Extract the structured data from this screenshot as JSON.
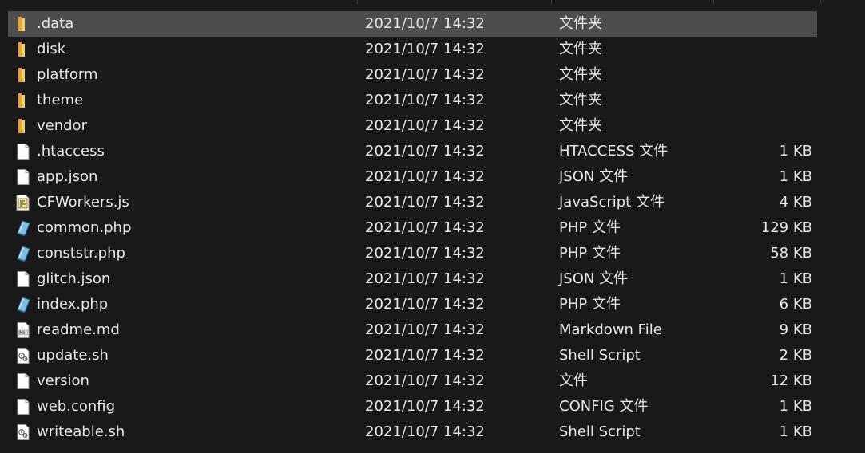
{
  "files": [
    {
      "name": ".data",
      "date": "2021/10/7 14:32",
      "type": "文件夹",
      "size": "",
      "icon": "folder-icon",
      "selected": true
    },
    {
      "name": "disk",
      "date": "2021/10/7 14:32",
      "type": "文件夹",
      "size": "",
      "icon": "folder-icon"
    },
    {
      "name": "platform",
      "date": "2021/10/7 14:32",
      "type": "文件夹",
      "size": "",
      "icon": "folder-icon"
    },
    {
      "name": "theme",
      "date": "2021/10/7 14:32",
      "type": "文件夹",
      "size": "",
      "icon": "folder-icon"
    },
    {
      "name": "vendor",
      "date": "2021/10/7 14:32",
      "type": "文件夹",
      "size": "",
      "icon": "folder-icon"
    },
    {
      "name": ".htaccess",
      "date": "2021/10/7 14:32",
      "type": "HTACCESS 文件",
      "size": "1 KB",
      "icon": "file-icon"
    },
    {
      "name": "app.json",
      "date": "2021/10/7 14:32",
      "type": "JSON 文件",
      "size": "1 KB",
      "icon": "file-icon"
    },
    {
      "name": "CFWorkers.js",
      "date": "2021/10/7 14:32",
      "type": "JavaScript 文件",
      "size": "4 KB",
      "icon": "js-file-icon"
    },
    {
      "name": "common.php",
      "date": "2021/10/7 14:32",
      "type": "PHP 文件",
      "size": "129 KB",
      "icon": "php-file-icon"
    },
    {
      "name": "conststr.php",
      "date": "2021/10/7 14:32",
      "type": "PHP 文件",
      "size": "58 KB",
      "icon": "php-file-icon"
    },
    {
      "name": "glitch.json",
      "date": "2021/10/7 14:32",
      "type": "JSON 文件",
      "size": "1 KB",
      "icon": "file-icon"
    },
    {
      "name": "index.php",
      "date": "2021/10/7 14:32",
      "type": "PHP 文件",
      "size": "6 KB",
      "icon": "php-file-icon"
    },
    {
      "name": "readme.md",
      "date": "2021/10/7 14:32",
      "type": "Markdown File",
      "size": "9 KB",
      "icon": "markdown-file-icon"
    },
    {
      "name": "update.sh",
      "date": "2021/10/7 14:32",
      "type": "Shell Script",
      "size": "2 KB",
      "icon": "shell-script-icon"
    },
    {
      "name": "version",
      "date": "2021/10/7 14:32",
      "type": "文件",
      "size": "12 KB",
      "icon": "file-icon"
    },
    {
      "name": "web.config",
      "date": "2021/10/7 14:32",
      "type": "CONFIG 文件",
      "size": "1 KB",
      "icon": "file-icon"
    },
    {
      "name": "writeable.sh",
      "date": "2021/10/7 14:32",
      "type": "Shell Script",
      "size": "1 KB",
      "icon": "shell-script-icon"
    }
  ],
  "colors": {
    "background": "#191919",
    "selected_row": "#4d4d4d",
    "text": "#e8e8e8",
    "folder": "#f4c55a"
  }
}
